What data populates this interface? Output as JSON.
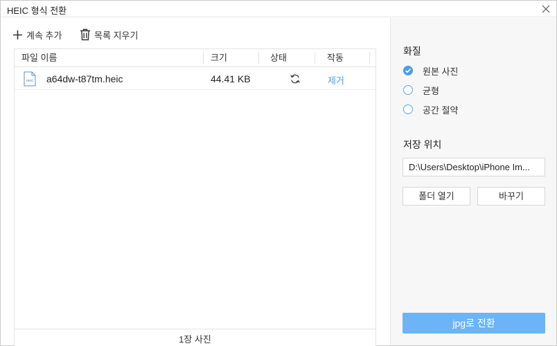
{
  "window": {
    "title": "HEIC 형식 전환"
  },
  "toolbar": {
    "add_label": "계속 추가",
    "clear_label": "목록 지우기"
  },
  "table": {
    "columns": [
      "파일 이름",
      "크기",
      "상태",
      "작동"
    ],
    "rows": [
      {
        "icon_text": "HEIC",
        "name": "a64dw-t87tm.heic",
        "size": "44.41 KB",
        "status_icon": "refresh-icon",
        "action": "제거"
      }
    ],
    "footer": "1장 사진"
  },
  "settings": {
    "quality_label": "화질",
    "quality_options": [
      "원본 사진",
      "균형",
      "공간 절약"
    ],
    "quality_selected": "원본 사진",
    "save_location_label": "저장 위치",
    "save_path": "D:\\Users\\Desktop\\iPhone Im...",
    "open_folder_label": "폴더 열기",
    "change_label": "바꾸기",
    "convert_label": "jpg로 전환"
  },
  "colors": {
    "accent": "#4a9fe8",
    "convert_button": "#6cb4f5",
    "panel_bg": "#f7f7f7"
  }
}
